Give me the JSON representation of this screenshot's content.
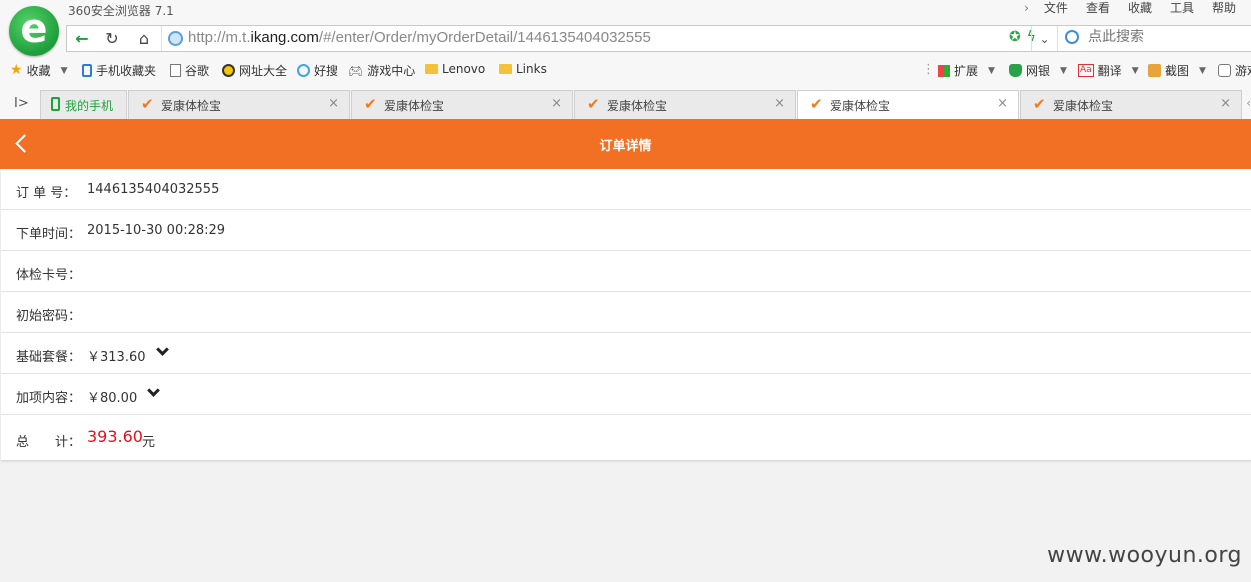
{
  "browser": {
    "title": "360安全浏览器 7.1",
    "menu": [
      "文件",
      "查看",
      "收藏",
      "工具",
      "帮助"
    ],
    "url_prefix": "http://m.t.",
    "url_domain": "ikang.com",
    "url_path": "/#/enter/Order/myOrderDetail/1446135404032555",
    "search_placeholder": "点此搜索"
  },
  "bookmarks": {
    "left": [
      "收藏",
      "手机收藏夹",
      "谷歌",
      "网址大全",
      "好搜",
      "游戏中心",
      "Lenovo",
      "Links"
    ],
    "right": [
      "扩展",
      "网银",
      "翻译",
      "截图",
      "游戏"
    ]
  },
  "tabs": {
    "mine": "我的手机",
    "items": [
      "爱康体检宝",
      "爱康体检宝",
      "爱康体检宝",
      "爱康体检宝",
      "爱康体检宝"
    ],
    "close_glyph": "×"
  },
  "page": {
    "title": "订单详情",
    "rows": {
      "order_no_label": "订 单 号：",
      "order_no_value": "1446135404032555",
      "time_label": "下单时间：",
      "time_value": "2015-10-30 00:28:29",
      "card_label": "体检卡号：",
      "password_label": "初始密码：",
      "base_label": "基础套餐：",
      "base_value": "￥313.60",
      "addon_label": "加项内容：",
      "addon_value": "￥80.00",
      "total_label": "总　　计：",
      "total_value": "393.60",
      "total_unit": "元"
    }
  },
  "watermark": "www.wooyun.org",
  "colors": {
    "header": "#f27024",
    "total": "#e4101c",
    "browser_green": "#1e9e3a"
  }
}
